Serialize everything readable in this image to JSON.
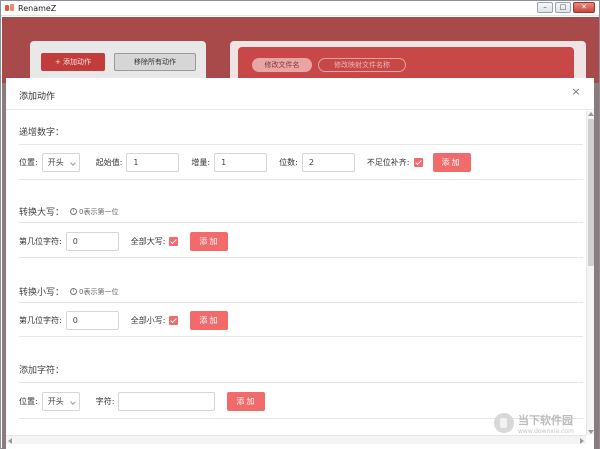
{
  "window": {
    "title": "RenameZ",
    "minimize": "–",
    "maximize": "□",
    "close": "✕"
  },
  "background": {
    "add_action_label": "+ 添加动作",
    "remove_all_label": "移除所有动作",
    "tab1_label": "修改文件名",
    "tab2_label": "修改映射文件名称"
  },
  "dialog": {
    "title": "添加动作",
    "close_icon": "×",
    "sections": {
      "increment": {
        "title": "递增数字：",
        "position_label": "位置:",
        "position_value": "开头",
        "start_label": "起始值:",
        "start_value": "1",
        "step_label": "增量:",
        "step_value": "1",
        "digits_label": "位数:",
        "digits_value": "2",
        "pad_label": "不足位补齐:",
        "add_label": "添加"
      },
      "uppercase": {
        "title": "转换大写：",
        "hint": "0表示第一位",
        "char_pos_label": "第几位字符:",
        "char_pos_value": "0",
        "all_label": "全部大写:",
        "add_label": "添加"
      },
      "lowercase": {
        "title": "转换小写：",
        "hint": "0表示第一位",
        "char_pos_label": "第几位字符:",
        "char_pos_value": "0",
        "all_label": "全部小写:",
        "add_label": "添加"
      },
      "add_chars": {
        "title": "添加字符：",
        "position_label": "位置:",
        "position_value": "开头",
        "chars_label": "字符:",
        "chars_value": "",
        "add_label": "添加"
      }
    }
  },
  "watermark": {
    "title": "当下软件园",
    "url": "www.downxia.com"
  },
  "colors": {
    "accent": "#f26b6b",
    "checkbox": "#f06b6b"
  }
}
